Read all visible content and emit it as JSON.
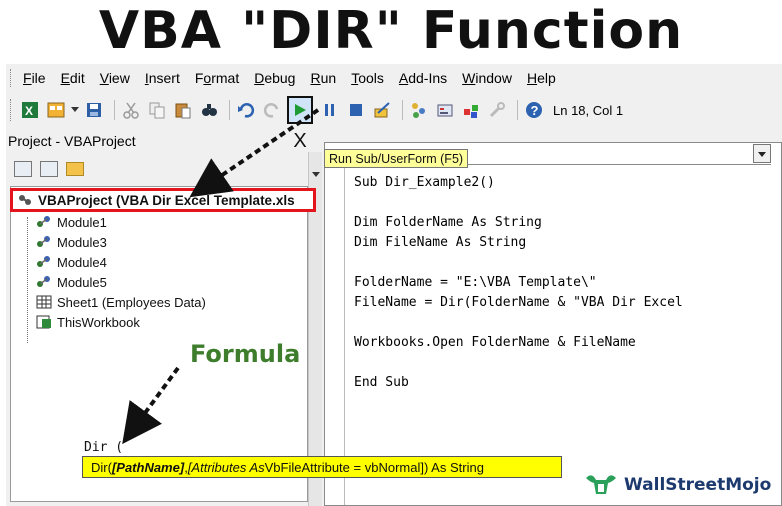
{
  "headline": "VBA \"DIR\" Function",
  "menu": [
    "File",
    "Edit",
    "View",
    "Insert",
    "Format",
    "Debug",
    "Run",
    "Tools",
    "Add-Ins",
    "Window",
    "Help"
  ],
  "menu_underline_index": [
    0,
    0,
    0,
    0,
    1,
    0,
    0,
    0,
    0,
    0,
    0
  ],
  "toolbar": {
    "position_readout": "Ln 18, Col 1",
    "run_tooltip": "Run Sub/UserForm (F5)"
  },
  "project": {
    "title": "Project - VBAProject",
    "close_label": "X",
    "root": "VBAProject (VBA Dir Excel Template.xls",
    "items": [
      {
        "label": "Module1",
        "icon": "module-icon"
      },
      {
        "label": "Module3",
        "icon": "module-icon"
      },
      {
        "label": "Module4",
        "icon": "module-icon"
      },
      {
        "label": "Module5",
        "icon": "module-icon"
      },
      {
        "label": "Sheet1 (Employees Data)",
        "icon": "sheet-icon"
      },
      {
        "label": "ThisWorkbook",
        "icon": "workbook-icon"
      }
    ]
  },
  "code": {
    "lines": [
      "Sub Dir_Example2()",
      "",
      "Dim FolderName As String",
      "Dim FileName As String",
      "",
      "FolderName = \"E:\\VBA Template\\\"",
      "FileName = Dir(FolderName & \"VBA Dir Excel",
      "",
      "Workbooks.Open FolderName & FileName",
      "",
      "End Sub"
    ]
  },
  "annotation": {
    "formula_label": "Formula",
    "typed_text": "Dir (",
    "signature": {
      "prefix": "Dir(",
      "param1": "[PathName]",
      "sep": ", ",
      "param2": "[Attributes As",
      "rest": " VbFileAttribute = vbNormal]) As String"
    }
  },
  "brand": {
    "name": "WallStreetMojo",
    "color": "#1d3a6e"
  },
  "colors": {
    "highlight_red": "#e3141b",
    "tooltip_yellow": "#ffff00",
    "formula_green": "#3d7d2b"
  }
}
